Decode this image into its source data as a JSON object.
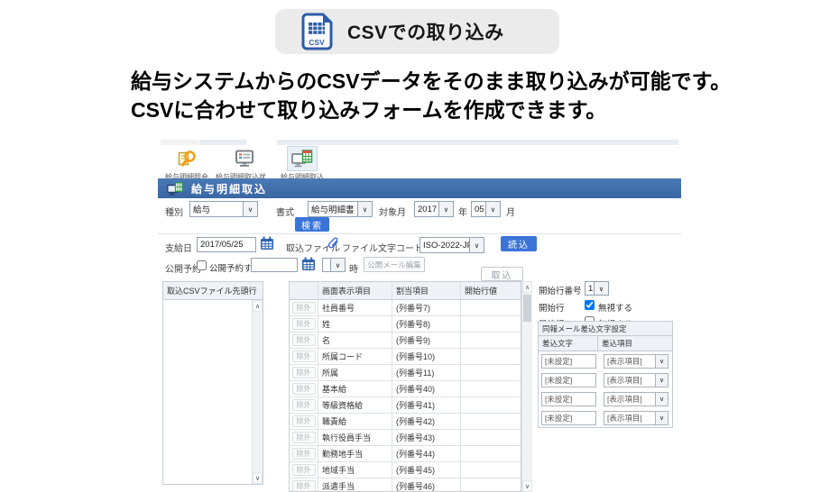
{
  "icons": {
    "scroll_up": "∧",
    "scroll_down": "∨",
    "dropdown_arrow": "∨"
  },
  "badge": {
    "icon_text": "CSV",
    "label": "CSVでの取り込み"
  },
  "headline": {
    "line1": "給与システムからのCSVデータをそのまま取り込みが可能です。",
    "line2": "CSVに合わせて取り込みフォームを作成できます。"
  },
  "toolbar": {
    "items": [
      {
        "label": "給与明細照会"
      },
      {
        "label": "給与明細取込状…"
      },
      {
        "label": "給与明細取込"
      }
    ]
  },
  "titlebar": {
    "title": "給与明細取込"
  },
  "filter": {
    "type_label": "種別",
    "type_value": "給与",
    "format_label": "書式",
    "format_value": "給与明細書",
    "target_label": "対象月",
    "year_value": "2017",
    "year_unit": "年",
    "month_value": "05",
    "month_unit": "月",
    "search_button": "検索"
  },
  "import": {
    "pay_date_label": "支給日",
    "pay_date_value": "2017/05/25",
    "file_label": "取込ファイル",
    "encoding_label": "ファイル文字コード",
    "encoding_value": "ISO-2022-JP",
    "load_button": "読込",
    "reserve_label": "公開予約",
    "reserve_checkbox_label": "公開予約する",
    "reserve_date_value": "",
    "reserve_hour_value": "",
    "hour_unit": "時",
    "mail_edit_button": "公開メール編集",
    "import_button": "取込"
  },
  "csv_panel": {
    "header": "取込CSVファイル先頭行"
  },
  "mapping": {
    "exclude_button": "除外",
    "headers": {
      "display": "画面表示項目",
      "assigned": "割当項目",
      "start_value": "開始行値"
    },
    "rows": [
      {
        "display": "社員番号",
        "assigned": "(列番号7)",
        "start": ""
      },
      {
        "display": "姓",
        "assigned": "(列番号8)",
        "start": ""
      },
      {
        "display": "名",
        "assigned": "(列番号9)",
        "start": ""
      },
      {
        "display": "所属コード",
        "assigned": "(列番号10)",
        "start": ""
      },
      {
        "display": "所属",
        "assigned": "(列番号11)",
        "start": ""
      },
      {
        "display": "基本給",
        "assigned": "(列番号40)",
        "start": ""
      },
      {
        "display": "等級資格給",
        "assigned": "(列番号41)",
        "start": ""
      },
      {
        "display": "職責給",
        "assigned": "(列番号42)",
        "start": ""
      },
      {
        "display": "執行役員手当",
        "assigned": "(列番号43)",
        "start": ""
      },
      {
        "display": "勤務地手当",
        "assigned": "(列番号44)",
        "start": ""
      },
      {
        "display": "地域手当",
        "assigned": "(列番号45)",
        "start": ""
      },
      {
        "display": "派遣手当",
        "assigned": "(列番号46)",
        "start": ""
      }
    ]
  },
  "options": {
    "start_row_label": "開始行番号",
    "start_row_value": "1",
    "first_row_label": "開始行",
    "first_row_checkbox_label": "無視する",
    "first_row_checked": true,
    "last_row_label": "最終行",
    "last_row_checkbox_label": "無視する",
    "last_row_checked": false
  },
  "mail_merge": {
    "header": "同報メール差込文字設定",
    "col_text": "差込文字",
    "col_item": "差込項目",
    "rows": [
      {
        "text": "[未設定]",
        "item": "[表示項目]"
      },
      {
        "text": "[未設定]",
        "item": "[表示項目]"
      },
      {
        "text": "[未設定]",
        "item": "[表示項目]"
      },
      {
        "text": "[未設定]",
        "item": "[表示項目]"
      }
    ]
  },
  "colors": {
    "titlebar_blue": "#3f6eae",
    "button_blue": "#3b74d8",
    "panel_header_gray": "#eef1f6",
    "badge_gray": "#ebebeb",
    "icon_blue": "#2d5ca8",
    "icon_green": "#2f9e44",
    "icon_orange": "#f39c12"
  }
}
